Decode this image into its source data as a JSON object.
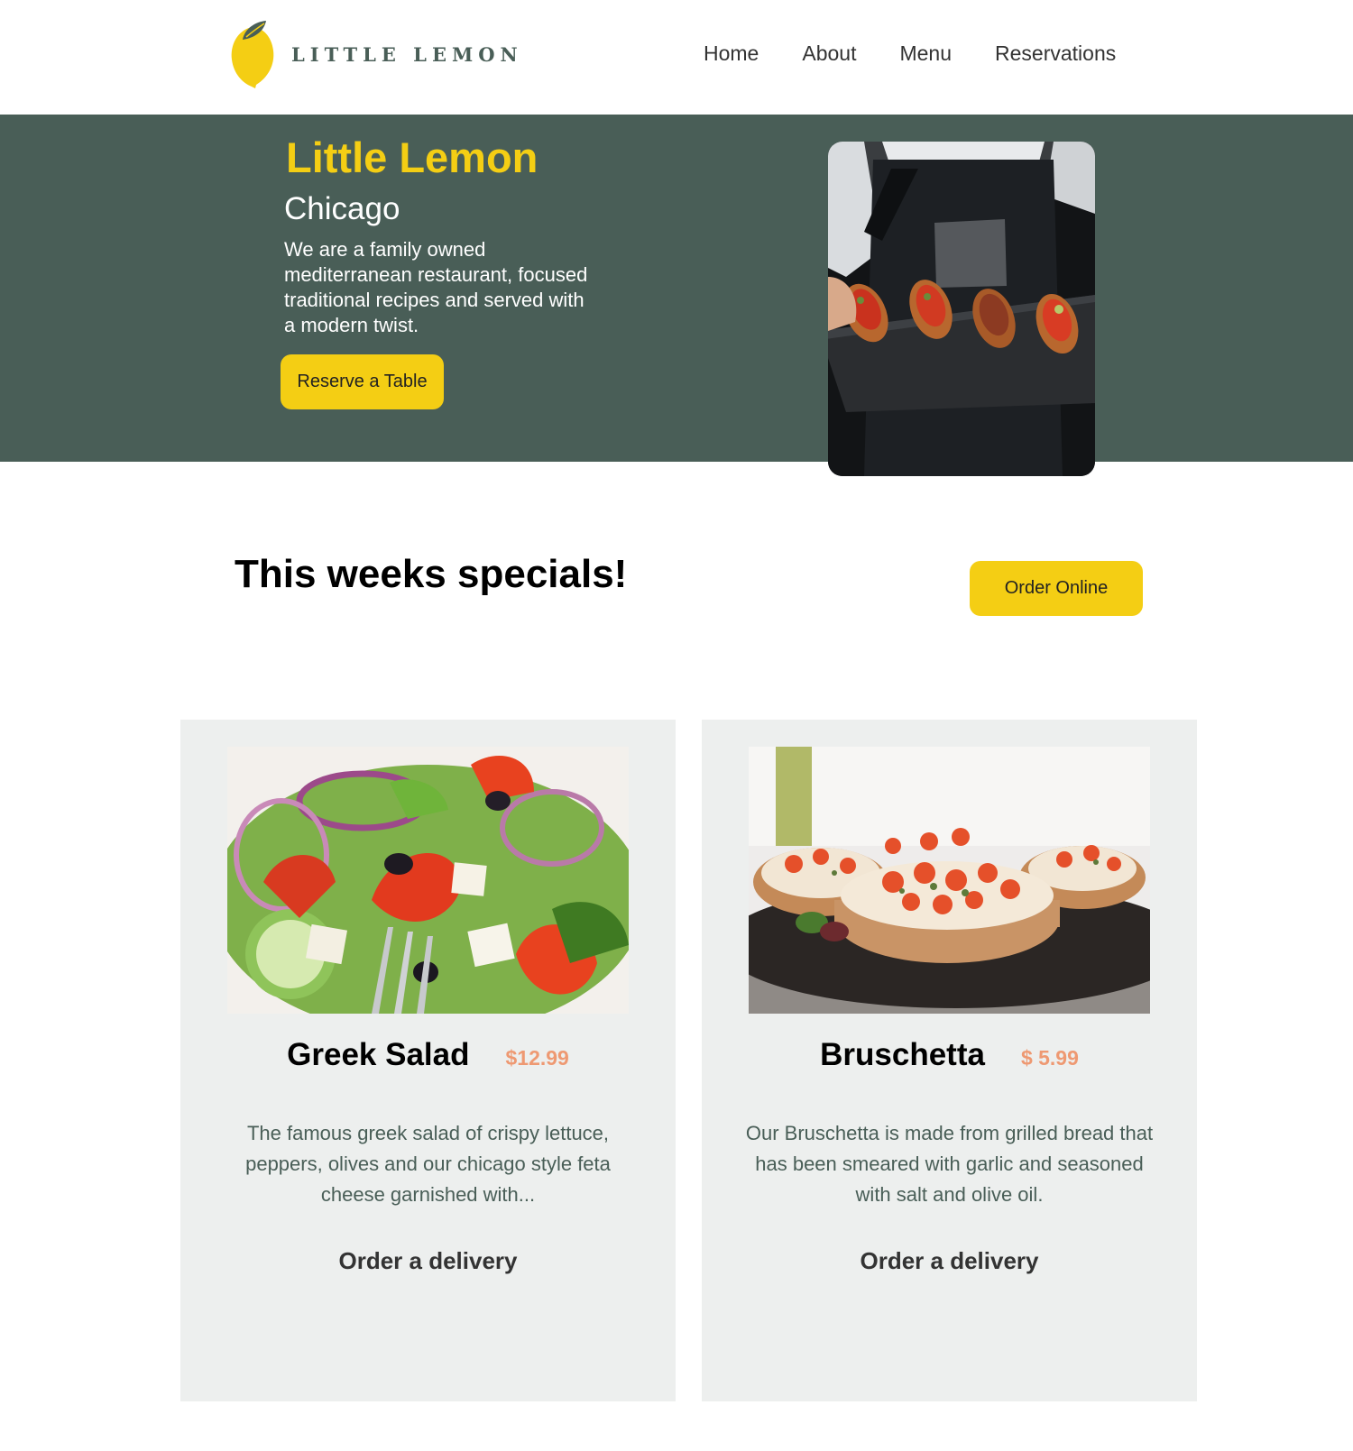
{
  "brand": {
    "logo_text": "LITTLE LEMON",
    "logo_icon": "lemon-logo-icon",
    "colors": {
      "primary_green": "#495e57",
      "primary_yellow": "#f4ce14",
      "price_salmon": "#ee9972",
      "card_bg": "#edefee"
    }
  },
  "nav": {
    "items": [
      {
        "label": "Home"
      },
      {
        "label": "About"
      },
      {
        "label": "Menu"
      },
      {
        "label": "Reservations"
      }
    ]
  },
  "hero": {
    "title": "Little Lemon",
    "city": "Chicago",
    "description": "We are a family owned mediterranean restaurant, focused traditional recipes and served with a modern twist.",
    "button_label": "Reserve a Table"
  },
  "specials": {
    "heading": "This weeks specials!",
    "order_button_label": "Order Online",
    "items": [
      {
        "name": "Greek Salad",
        "price": "$12.99",
        "description": "The famous greek salad of crispy lettuce, peppers, olives and our chicago style feta cheese garnished with...",
        "link_label": "Order a delivery"
      },
      {
        "name": "Bruschetta",
        "price": "$ 5.99",
        "description": "Our Bruschetta is made from grilled bread that has been smeared with garlic and seasoned with salt and olive oil.",
        "link_label": "Order a delivery"
      }
    ]
  }
}
